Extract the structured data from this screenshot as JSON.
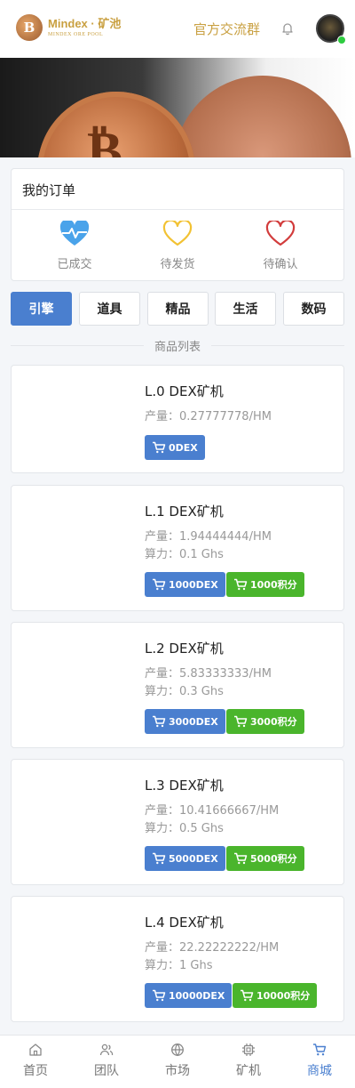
{
  "header": {
    "logo_title": "Mindex · 矿池",
    "logo_sub": "MINDEX ORE POOL",
    "logo_mark": "B",
    "group_link": "官方交流群"
  },
  "orders": {
    "title": "我的订单",
    "items": [
      {
        "label": "已成交",
        "icon": "heartbeat-icon",
        "color": "#4aa3ea"
      },
      {
        "label": "待发货",
        "icon": "heart-outline-icon",
        "color": "#f2c233"
      },
      {
        "label": "待确认",
        "icon": "heart-outline-icon",
        "color": "#d23c3c"
      }
    ]
  },
  "tabs": [
    "引擎",
    "道具",
    "精品",
    "生活",
    "数码"
  ],
  "active_tab": "引擎",
  "list_title": "商品列表",
  "products": [
    {
      "name": "L.0 DEX矿机",
      "output": "产量：0.27777778/HM",
      "power": "",
      "buttons": [
        "0DEX"
      ]
    },
    {
      "name": "L.1 DEX矿机",
      "output": "产量：1.94444444/HM",
      "power": "算力：0.1 Ghs",
      "buttons": [
        "1000DEX",
        "1000积分"
      ]
    },
    {
      "name": "L.2 DEX矿机",
      "output": "产量：5.83333333/HM",
      "power": "算力：0.3 Ghs",
      "buttons": [
        "3000DEX",
        "3000积分"
      ]
    },
    {
      "name": "L.3 DEX矿机",
      "output": "产量：10.41666667/HM",
      "power": "算力：0.5 Ghs",
      "buttons": [
        "5000DEX",
        "5000积分"
      ]
    },
    {
      "name": "L.4 DEX矿机",
      "output": "产量：22.22222222/HM",
      "power": "算力：1 Ghs",
      "buttons": [
        "10000DEX",
        "10000积分"
      ]
    }
  ],
  "nav": [
    {
      "label": "首页",
      "icon": "home-icon"
    },
    {
      "label": "团队",
      "icon": "team-icon"
    },
    {
      "label": "市场",
      "icon": "globe-icon"
    },
    {
      "label": "矿机",
      "icon": "chip-icon"
    },
    {
      "label": "商城",
      "icon": "cart-icon"
    }
  ],
  "active_nav": "商城",
  "colors": {
    "accent": "#4a7fcf",
    "gold": "#c9a041",
    "green_button": "#4ab52c",
    "online": "#2ecc40"
  }
}
